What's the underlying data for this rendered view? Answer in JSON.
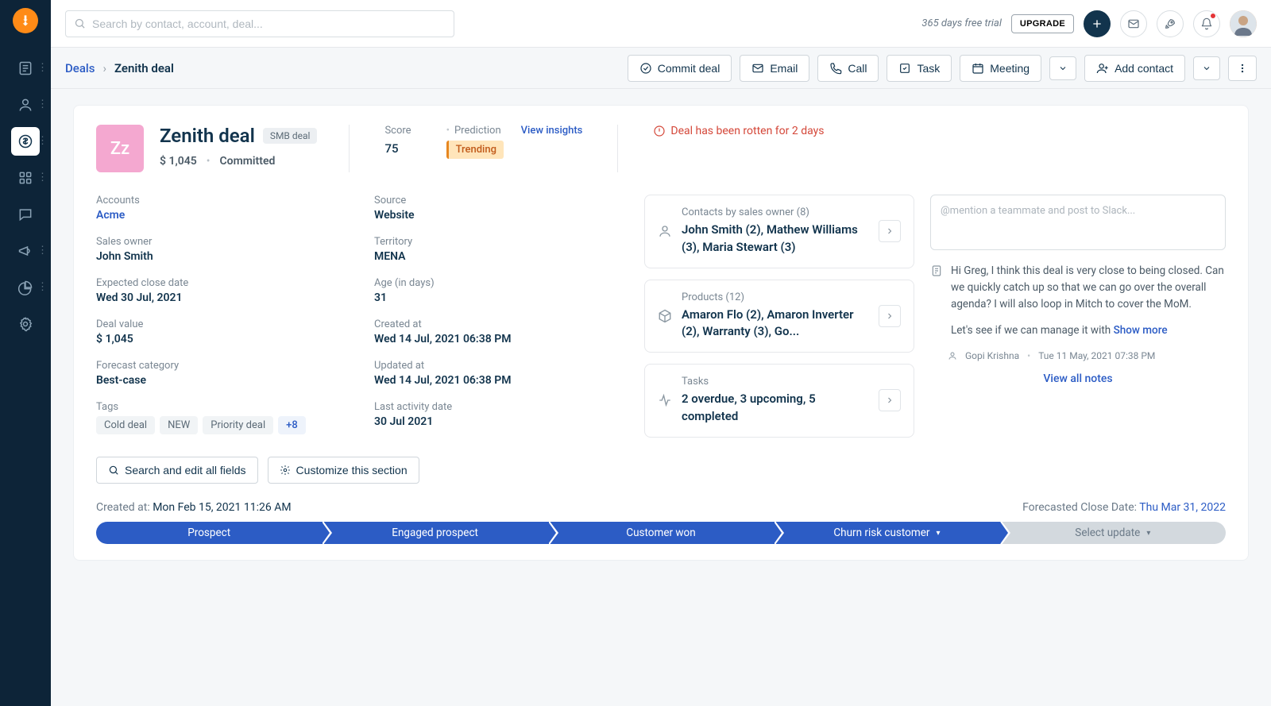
{
  "topbar": {
    "search_placeholder": "Search by contact, account, deal...",
    "trial_text": "365 days free trial",
    "upgrade": "UPGRADE"
  },
  "breadcrumb": {
    "root": "Deals",
    "current": "Zenith deal"
  },
  "actions": {
    "commit": "Commit deal",
    "email": "Email",
    "call": "Call",
    "task": "Task",
    "meeting": "Meeting",
    "add_contact": "Add contact"
  },
  "deal": {
    "initials": "Zz",
    "title": "Zenith deal",
    "pill": "SMB deal",
    "amount": "$ 1,045",
    "status": "Committed",
    "score_label": "Score",
    "score": "75",
    "prediction_label": "Prediction",
    "prediction_badge": "Trending",
    "insights_link": "View insights",
    "rotten_msg": "Deal has been rotten for 2 days"
  },
  "fields_left": {
    "accounts_label": "Accounts",
    "accounts": "Acme",
    "owner_label": "Sales owner",
    "owner": "John Smith",
    "close_label": "Expected close date",
    "close": "Wed 30 Jul, 2021",
    "value_label": "Deal value",
    "value": "$ 1,045",
    "forecast_label": "Forecast category",
    "forecast": "Best-case",
    "tags_label": "Tags",
    "tags": [
      "Cold deal",
      "NEW",
      "Priority deal"
    ],
    "tags_more": "+8"
  },
  "fields_right": {
    "source_label": "Source",
    "source": "Website",
    "territory_label": "Territory",
    "territory": "MENA",
    "age_label": "Age (in days)",
    "age": "31",
    "created_label": "Created at",
    "created": "Wed 14 Jul, 2021 06:38 PM",
    "updated_label": "Updated at",
    "updated": "Wed 14 Jul, 2021 06:38 PM",
    "last_label": "Last activity date",
    "last": "30 Jul 2021"
  },
  "side_cards": {
    "contacts_head": "Contacts by sales owner (8)",
    "contacts_body": "John Smith (2), Mathew Williams (3), Maria Stewart (3)",
    "products_head": "Products (12)",
    "products_body": "Amaron Flo (2), Amaron Inverter (2), Warranty (3), Go...",
    "tasks_head": "Tasks",
    "tasks_body": "2 overdue, 3 upcoming, 5 completed"
  },
  "notes": {
    "mention_placeholder": "@mention a teammate and post to Slack...",
    "body": "Hi Greg, I think this deal is very close to being closed. Can we quickly catch up so that we can go over the overall agenda? I will also loop in Mitch to cover the MoM.",
    "body2": "Let's see if we can manage it with ",
    "show_more": "Show more",
    "author": "Gopi Krishna",
    "date": "Tue 11 May, 2021 07:38 PM",
    "view_all": "View all notes"
  },
  "footer_btns": {
    "search": "Search and edit all fields",
    "customize": "Customize this section"
  },
  "footer": {
    "created_label": "Created at: ",
    "created": "Mon Feb 15, 2021 11:26 AM",
    "forecast_label": "Forecasted Close Date: ",
    "forecast": "Thu Mar 31, 2022"
  },
  "pipeline": [
    "Prospect",
    "Engaged prospect",
    "Customer won",
    "Churn risk customer",
    "Select update"
  ]
}
